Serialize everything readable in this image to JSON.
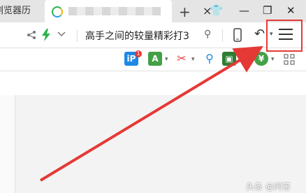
{
  "tabs": {
    "previous_label": "浏览器历",
    "close_glyph": "×",
    "new_tab_glyph": "+"
  },
  "window": {
    "skin_glyph": "👕",
    "minimize_glyph": "—",
    "restore_glyph": "❐",
    "close_glyph": "✕"
  },
  "address": {
    "url_text": "高手之间的较量精彩打3",
    "search_glyph": "⚲",
    "back_glyph": "↶"
  },
  "extensions": [
    {
      "name": "ext-ip",
      "color": "#1e88e5",
      "label": "iP",
      "badge": "1"
    },
    {
      "name": "ext-translate",
      "color": "#43a047",
      "label": "A"
    },
    {
      "name": "ext-scissors",
      "color": "#e53935",
      "label": "✂"
    },
    {
      "name": "ext-search",
      "color": "#1e88e5",
      "label": "⚲"
    },
    {
      "name": "ext-game",
      "color": "#2e7d32",
      "label": "▣"
    },
    {
      "name": "ext-money",
      "color": "#43a047",
      "label": "¥"
    }
  ],
  "watermark": "头条 @问答",
  "colors": {
    "highlight": "#e53935",
    "arrow": "#e53935"
  }
}
